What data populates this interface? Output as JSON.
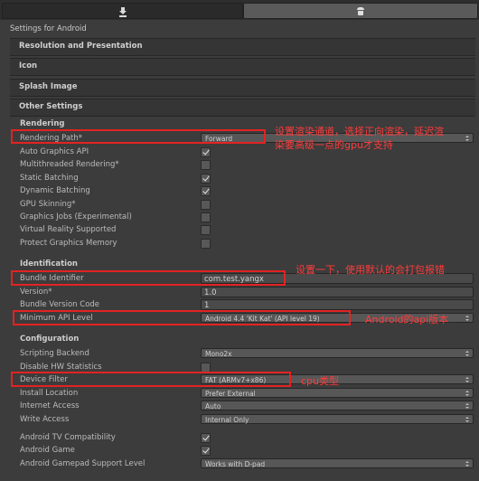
{
  "header": {
    "settings_title": "Settings for Android"
  },
  "sections": {
    "resolution": "Resolution and Presentation",
    "icon": "Icon",
    "splash": "Splash Image",
    "other": "Other Settings"
  },
  "rendering": {
    "title": "Rendering",
    "rendering_path_label": "Rendering Path*",
    "rendering_path_value": "Forward",
    "auto_graphics_label": "Auto Graphics API",
    "multithreaded_label": "Multithreaded Rendering*",
    "static_batching_label": "Static Batching",
    "dynamic_batching_label": "Dynamic Batching",
    "gpu_skinning_label": "GPU Skinning*",
    "graphics_jobs_label": "Graphics Jobs (Experimental)",
    "vr_label": "Virtual Reality Supported",
    "protect_label": "Protect Graphics Memory",
    "checked": {
      "auto_graphics": true,
      "multithreaded": false,
      "static_batching": true,
      "dynamic_batching": true,
      "gpu_skinning": false,
      "graphics_jobs": false,
      "vr": false,
      "protect": false
    }
  },
  "identification": {
    "title": "Identification",
    "bundle_id_label": "Bundle Identifier",
    "bundle_id_value": "com.test.yangx",
    "version_label": "Version*",
    "version_value": "1.0",
    "bundle_code_label": "Bundle Version Code",
    "bundle_code_value": "1",
    "min_api_label": "Minimum API Level",
    "min_api_value": "Android 4.4 'Kit Kat' (API level 19)"
  },
  "configuration": {
    "title": "Configuration",
    "scripting_label": "Scripting Backend",
    "scripting_value": "Mono2x",
    "disable_hw_label": "Disable HW Statistics",
    "device_filter_label": "Device Filter",
    "device_filter_value": "FAT (ARMv7+x86)",
    "install_label": "Install Location",
    "install_value": "Prefer External",
    "internet_label": "Internet Access",
    "internet_value": "Auto",
    "write_label": "Write Access",
    "write_value": "Internal Only",
    "tv_label": "Android TV Compatibility",
    "game_label": "Android Game",
    "gamepad_label": "Android Gamepad Support Level",
    "gamepad_value": "Works with D-pad",
    "checked": {
      "disable_hw": false,
      "tv": true,
      "game": true
    }
  },
  "annotations": {
    "rendering_note_line1": "设置渲染通道，选择正向渲染，延迟渲",
    "rendering_note_line2": "染要高级一点的gpu才支持",
    "bundle_note": "设置一下，使用默认的会打包报错",
    "api_note": "Android的api版本",
    "cpu_note": "cpu类型"
  },
  "colors": {
    "annotation_red": "#e32222",
    "panel_bg": "#3c3c3c"
  }
}
